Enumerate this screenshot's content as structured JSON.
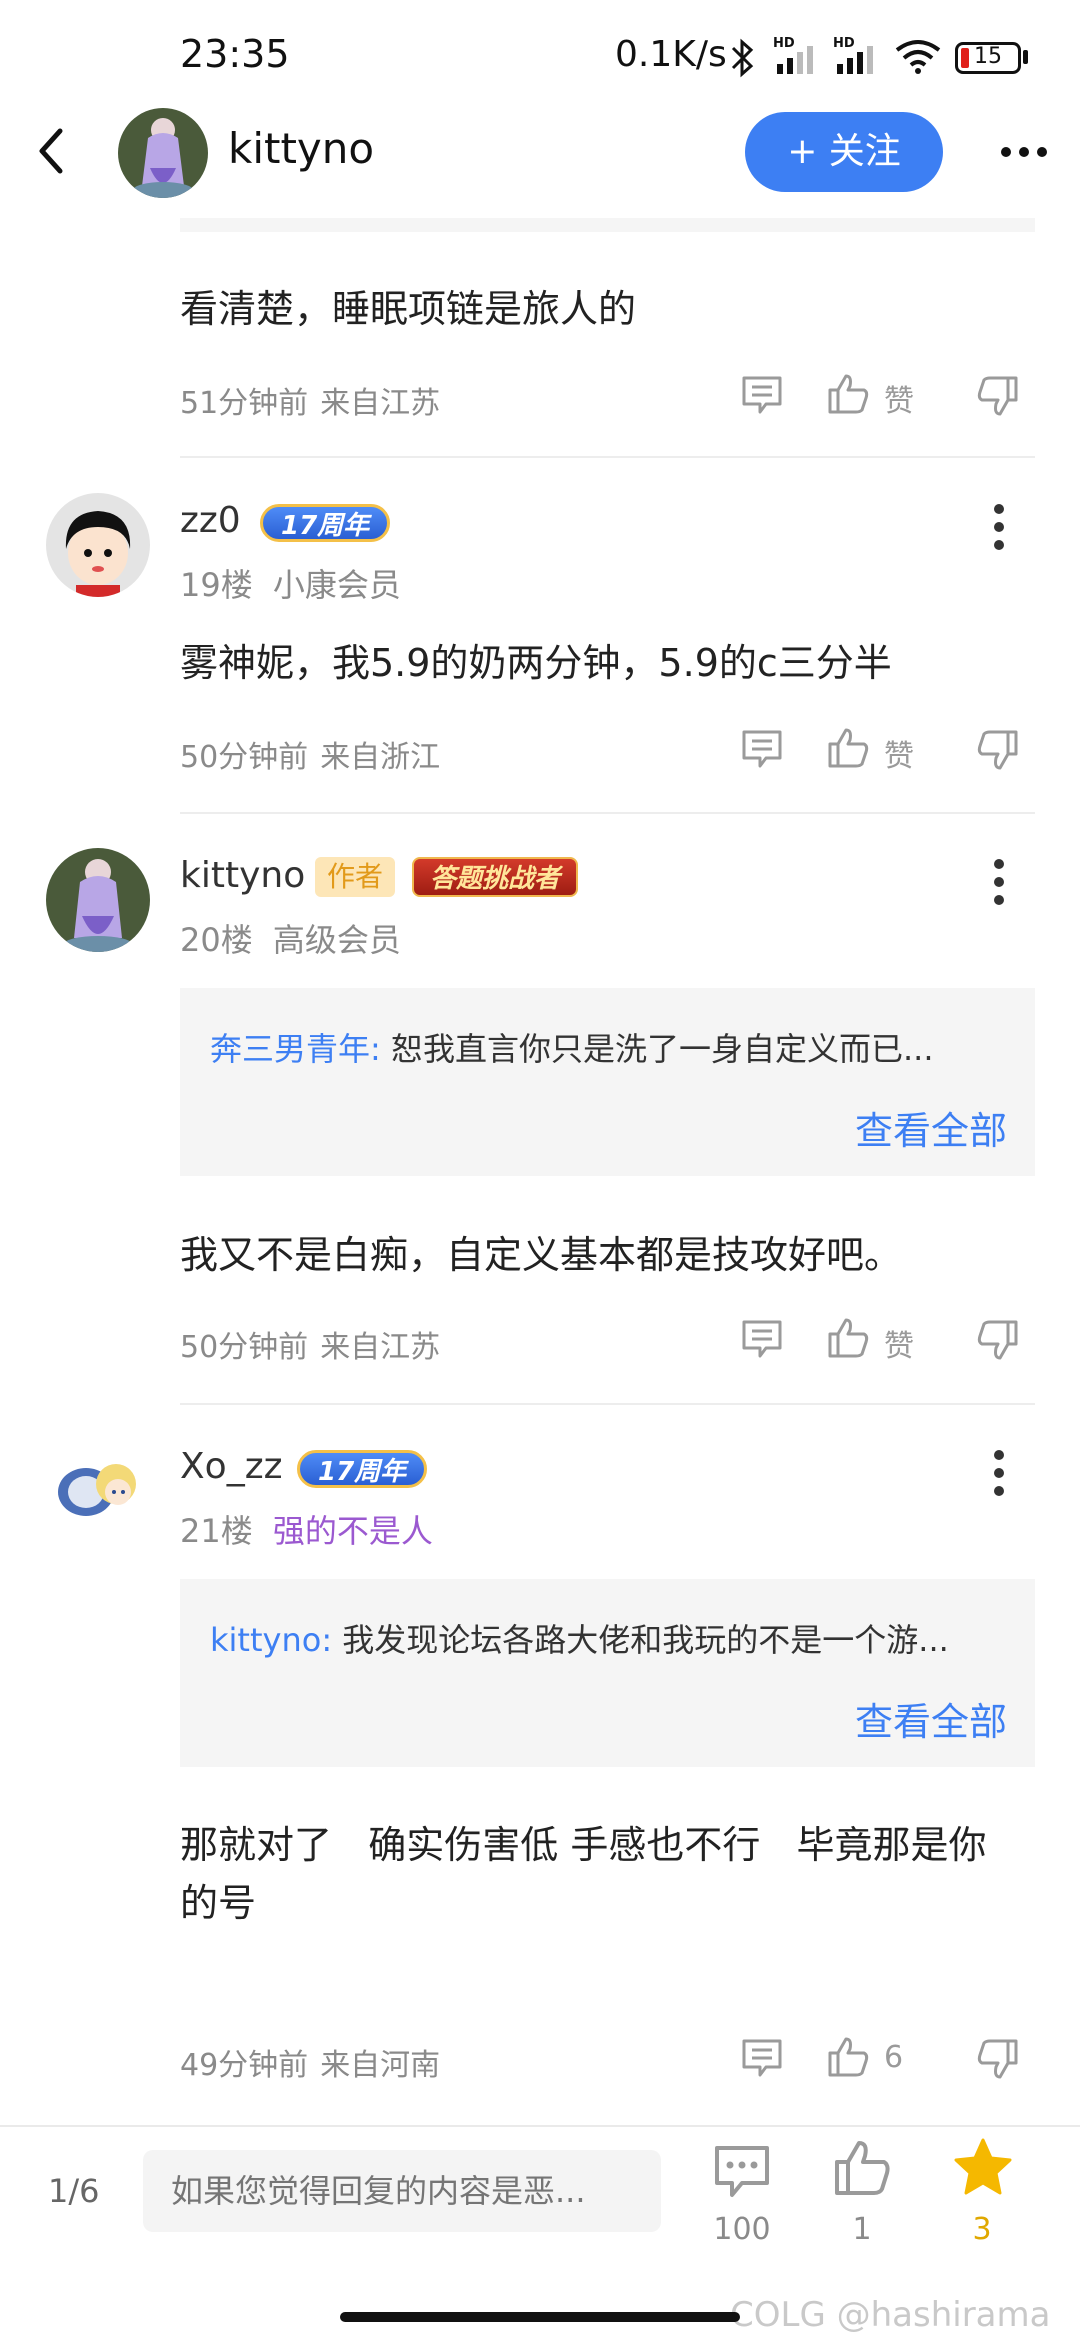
{
  "status_bar": {
    "time": "23:35",
    "net_speed": "0.1K/s",
    "battery": "15",
    "hd_label": "HD"
  },
  "header": {
    "name": "kittyno",
    "follow_label": "+ 关注"
  },
  "top_comment": {
    "text": "看清楚，睡眠项链是旅人的",
    "time": "51分钟前",
    "location": "来自江苏",
    "like_label": "赞"
  },
  "posts": [
    {
      "username": "zz0",
      "badge": "17周年",
      "floor": "19楼",
      "level": "小康会员",
      "text": "雾神妮，我5.9的奶两分钟，5.9的c三分半",
      "time": "50分钟前",
      "location": "来自浙江",
      "like_label": "赞"
    },
    {
      "username": "kittyno",
      "author_badge": "作者",
      "badge": "答题挑战者",
      "floor": "20楼",
      "level": "高级会员",
      "quote_user": "奔三男青年:",
      "quote_text": "恕我直言你只是洗了一身自定义而已...",
      "quote_more": "查看全部",
      "text": "我又不是白痴，自定义基本都是技攻好吧。",
      "time": "50分钟前",
      "location": "来自江苏",
      "like_label": "赞"
    },
    {
      "username": "Xo_zz",
      "badge": "17周年",
      "floor": "21楼",
      "level": "强的不是人",
      "quote_user": "kittyno:",
      "quote_text": "我发现论坛各路大佬和我玩的不是一个游...",
      "quote_more": "查看全部",
      "text_line1": "那就对了   确实伤害低 手感也不行   毕竟那是你",
      "text_line2": "的号",
      "time": "49分钟前",
      "location": "来自河南",
      "like_label": "6"
    }
  ],
  "bottom_bar": {
    "page": "1/6",
    "reply_placeholder": "如果您觉得回复的内容是恶...",
    "comments_count": "100",
    "likes_count": "1",
    "favorites_count": "3"
  },
  "watermark": "COLG @hashirama",
  "colors": {
    "accent": "#3d7ff3",
    "star": "#f5b800",
    "level_purple": "#9b59d0"
  },
  "icons": [
    "back-icon",
    "more-icon",
    "comment-icon",
    "thumb-up-icon",
    "thumb-down-icon",
    "star-icon",
    "wifi-icon",
    "bluetooth-icon",
    "signal-icon",
    "battery-icon"
  ]
}
